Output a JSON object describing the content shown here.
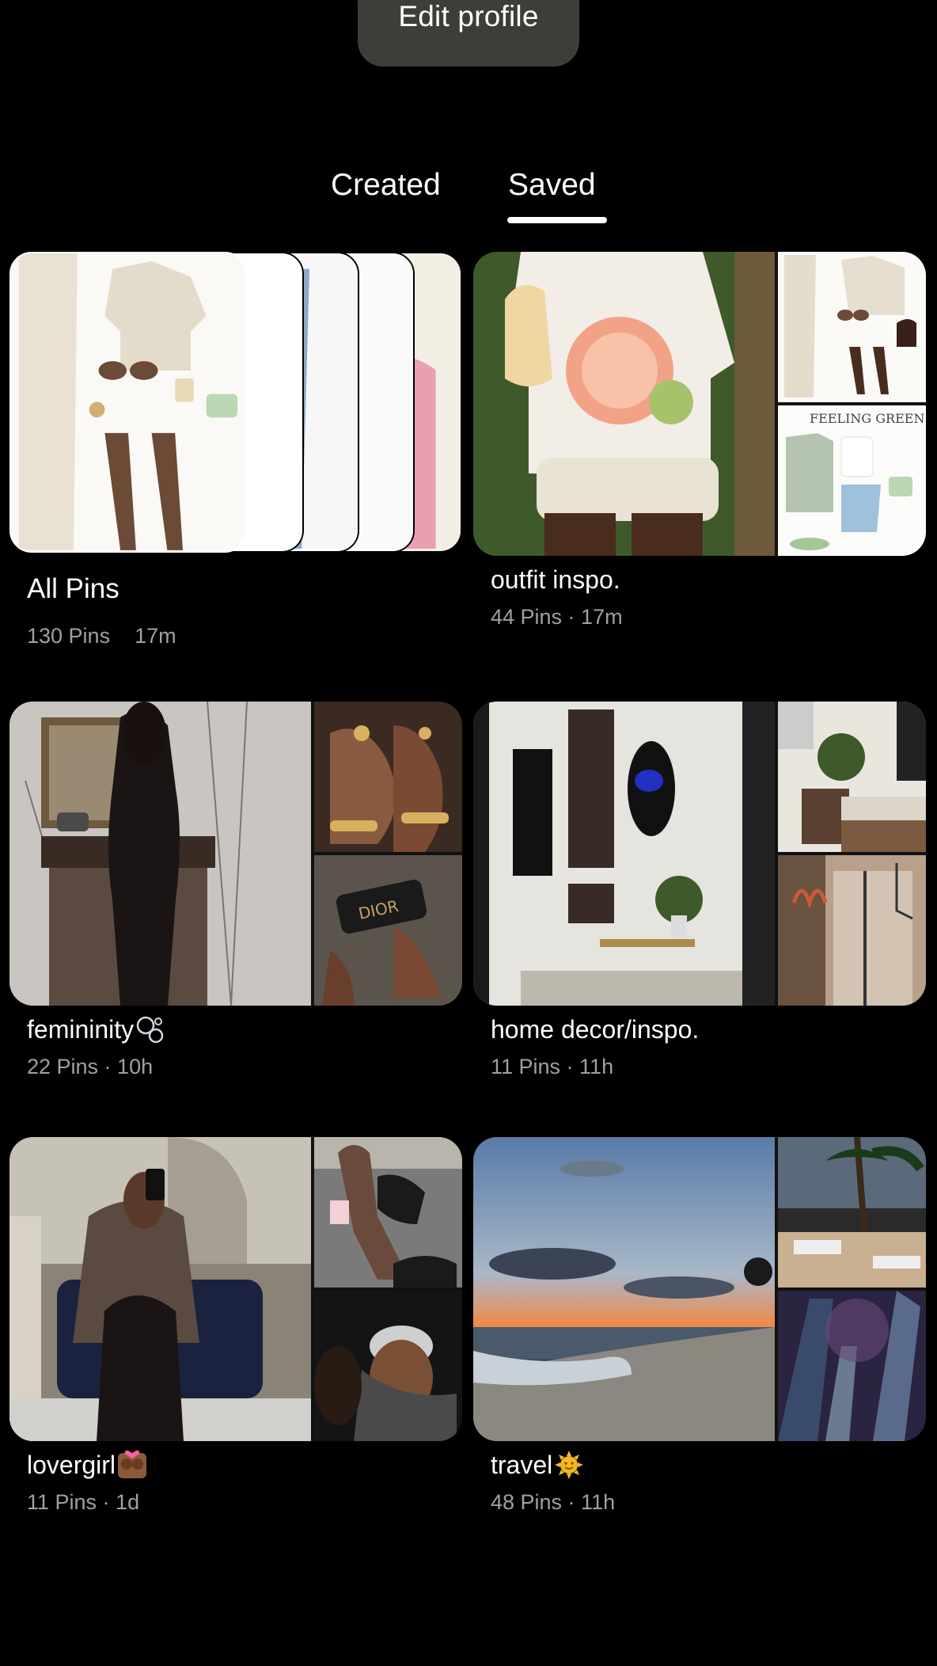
{
  "header": {
    "edit_profile_label": "Edit profile"
  },
  "tabs": [
    {
      "label": "Created",
      "active": false
    },
    {
      "label": "Saved",
      "active": true
    }
  ],
  "boards": [
    {
      "title": "All Pins",
      "pins": "130 Pins",
      "time": "17m"
    },
    {
      "title": "outfit inspo.",
      "meta": "44 Pins · 17m"
    },
    {
      "title": "femininity",
      "emoji": "bubbles-emoji",
      "meta": "22 Pins · 10h"
    },
    {
      "title": "home decor/inspo.",
      "meta": "11 Pins · 11h"
    },
    {
      "title": "lovergirl",
      "emoji": "kiss-couple-emoji",
      "meta": "11 Pins · 1d"
    },
    {
      "title": "travel",
      "emoji": "sun-face-emoji",
      "meta": "48 Pins · 11h"
    }
  ],
  "colors": {
    "background": "#000000",
    "button": "#3e3e38",
    "meta_text": "#a0a0a0"
  }
}
